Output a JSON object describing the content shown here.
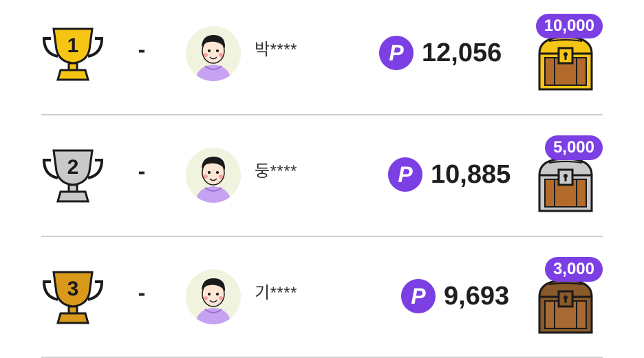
{
  "leaderboard": [
    {
      "rank": "1",
      "trophy_icon": "gold-trophy-icon",
      "trophy_color": "#f6c514",
      "change": "-",
      "username": "박****",
      "points": "12,056",
      "reward": "10,000",
      "chest_icon": "gold-treasure-chest-icon",
      "chest_color": "#f6c514"
    },
    {
      "rank": "2",
      "trophy_icon": "silver-trophy-icon",
      "trophy_color": "#c9c9c9",
      "change": "-",
      "username": "둥****",
      "points": "10,885",
      "reward": "5,000",
      "chest_icon": "silver-treasure-chest-icon",
      "chest_color": "#c9c9c9"
    },
    {
      "rank": "3",
      "trophy_icon": "bronze-trophy-icon",
      "trophy_color": "#d99a1c",
      "change": "-",
      "username": "기****",
      "points": "9,693",
      "reward": "3,000",
      "chest_icon": "bronze-treasure-chest-icon",
      "chest_color": "#8a5a2b"
    }
  ],
  "colors": {
    "accent_purple": "#7b3fe4",
    "divider": "#cfcfcf",
    "chest_wood": "#b36b2c",
    "avatar_bg": "#f0f4df"
  },
  "point_icon": "p-point-icon"
}
